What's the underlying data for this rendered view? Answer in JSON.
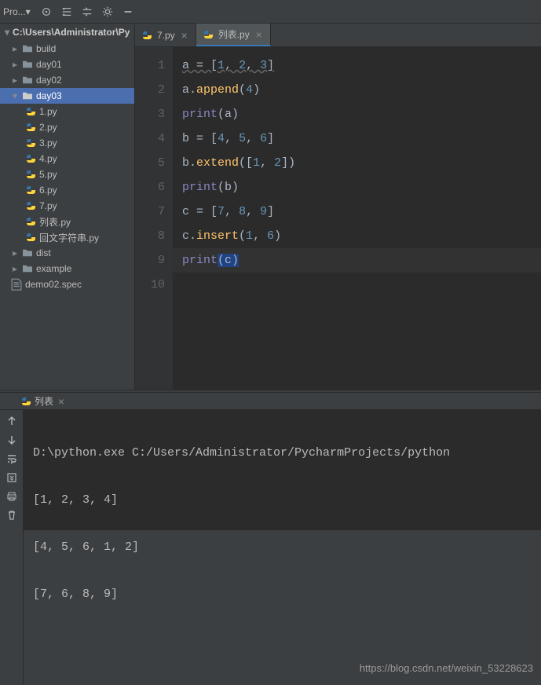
{
  "toolbar": {
    "project_label": "Pro...▾"
  },
  "breadcrumb": "C:\\Users\\Administrator\\Py",
  "tree": {
    "folders_top": [
      {
        "label": "build"
      },
      {
        "label": "day01"
      },
      {
        "label": "day02"
      }
    ],
    "selected_folder": "day03",
    "files_under_selected": [
      {
        "label": "1.py"
      },
      {
        "label": "2.py"
      },
      {
        "label": "3.py"
      },
      {
        "label": "4.py"
      },
      {
        "label": "5.py"
      },
      {
        "label": "6.py"
      },
      {
        "label": "7.py"
      },
      {
        "label": "列表.py"
      },
      {
        "label": "回文字符串.py"
      }
    ],
    "folders_bottom": [
      {
        "label": "dist"
      },
      {
        "label": "example"
      }
    ],
    "spec_file": "demo02.spec"
  },
  "tabs": [
    {
      "label": "7.py",
      "active": false
    },
    {
      "label": "列表.py",
      "active": true
    }
  ],
  "editor": {
    "line_numbers": [
      "1",
      "2",
      "3",
      "4",
      "5",
      "6",
      "7",
      "8",
      "9",
      "10"
    ]
  },
  "run": {
    "tab_label": "列表",
    "command": "D:\\python.exe C:/Users/Administrator/PycharmProjects/python",
    "output": [
      "[1, 2, 3, 4]",
      "[4, 5, 6, 1, 2]",
      "[7, 6, 8, 9]"
    ]
  },
  "watermark": "https://blog.csdn.net/weixin_53228623",
  "code": {
    "l1": {
      "v": "a",
      "e": " = ",
      "b1": "[",
      "n1": "1",
      "c1": ", ",
      "n2": "2",
      "c2": ", ",
      "n3": "3",
      "b2": "]"
    },
    "l2": {
      "v": "a.",
      "f": "append",
      "p1": "(",
      "n": "4",
      "p2": ")"
    },
    "l3": {
      "f": "print",
      "p1": "(",
      "v": "a",
      "p2": ")"
    },
    "l4": {
      "v": "b",
      "e": " = ",
      "b1": "[",
      "n1": "4",
      "c1": ", ",
      "n2": "5",
      "c2": ", ",
      "n3": "6",
      "b2": "]"
    },
    "l5": {
      "v": "b.",
      "f": "extend",
      "p1": "([",
      "n1": "1",
      "c": ", ",
      "n2": "2",
      "p2": "])"
    },
    "l6": {
      "f": "print",
      "p1": "(",
      "v": "b",
      "p2": ")"
    },
    "l7": {
      "v": "c",
      "e": " = ",
      "b1": "[",
      "n1": "7",
      "c1": ", ",
      "n2": "8",
      "c2": ", ",
      "n3": "9",
      "b2": "]"
    },
    "l8": {
      "v": "c.",
      "f": "insert",
      "p1": "(",
      "n1": "1",
      "c": ", ",
      "n2": "6",
      "p2": ")"
    },
    "l9": {
      "f": "print",
      "p1": "(",
      "v": "c",
      "p2": ")"
    }
  }
}
